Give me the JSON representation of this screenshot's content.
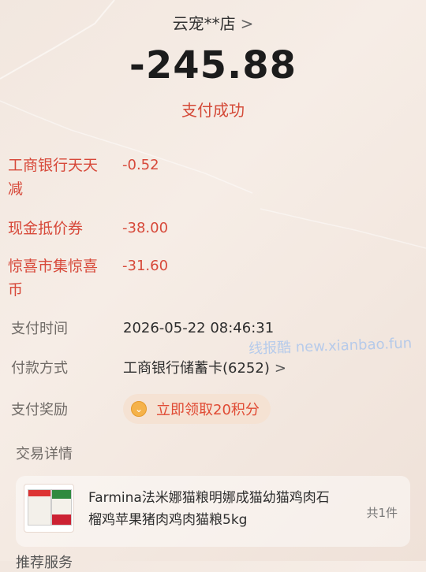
{
  "merchant": {
    "name": "云宠**店",
    "chevron": ">"
  },
  "payment": {
    "amount": "-245.88",
    "status": "支付成功"
  },
  "discounts": [
    {
      "label": "工商银行天天减",
      "value": "-0.52"
    },
    {
      "label": "现金抵价券",
      "value": "-38.00"
    },
    {
      "label": "惊喜市集惊喜币",
      "value": "-31.60"
    }
  ],
  "details": {
    "pay_time_label": "支付时间",
    "pay_time_value": "2026-05-22 08:46:31",
    "pay_method_label": "付款方式",
    "pay_method_value": "工商银行储蓄卡(6252)",
    "pay_method_chevron": ">",
    "reward_label": "支付奖励",
    "reward_button": "立即领取20积分",
    "trade_label": "交易详情"
  },
  "product": {
    "title": "Farmina法米娜猫粮明娜成猫幼猫鸡肉石榴鸡苹果猪肉鸡肉猫粮5kg",
    "quantity": "共1件"
  },
  "footer": {
    "partial_text": "推荐服务"
  },
  "watermark": {
    "text": "线报酷 new.xianbao.fun"
  },
  "colors": {
    "accent_red": "#d7493a",
    "reward_bg": "#f5e2d3",
    "coin": "#f5b24a"
  }
}
